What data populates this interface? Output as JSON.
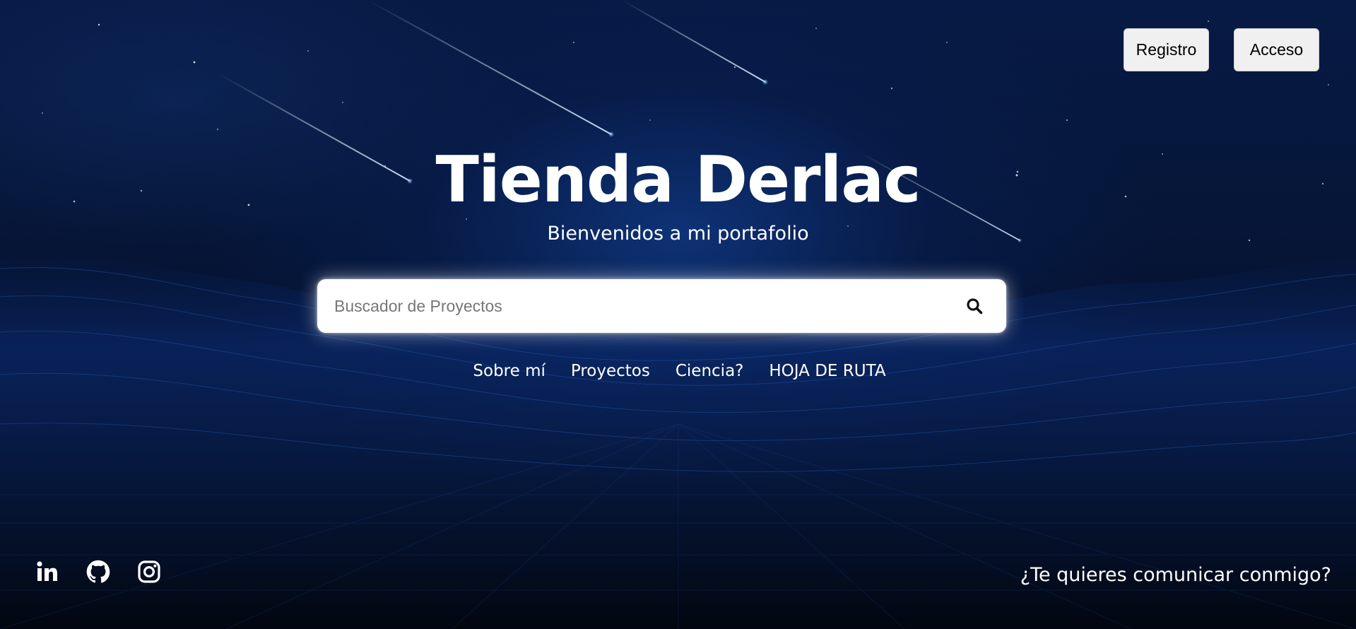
{
  "header": {
    "register_label": "Registro",
    "login_label": "Acceso"
  },
  "hero": {
    "title": "Tienda Derlac",
    "subtitle": "Bienvenidos a mi portafolio"
  },
  "search": {
    "placeholder": "Buscador de Proyectos",
    "value": "",
    "icon": "search-icon"
  },
  "nav": {
    "items": [
      {
        "label": "Sobre mí"
      },
      {
        "label": "Proyectos"
      },
      {
        "label": "Ciencia?"
      },
      {
        "label": "HOJA DE RUTA"
      }
    ]
  },
  "footer": {
    "socials": [
      {
        "icon": "linkedin-icon"
      },
      {
        "icon": "github-icon"
      },
      {
        "icon": "instagram-icon"
      }
    ],
    "contact_label": "¿Te quieres comunicar conmigo?"
  },
  "colors": {
    "background": "#04102c",
    "accent_blue": "#1a4fa0",
    "text": "#ffffff",
    "button_bg": "#f0f0f0"
  }
}
